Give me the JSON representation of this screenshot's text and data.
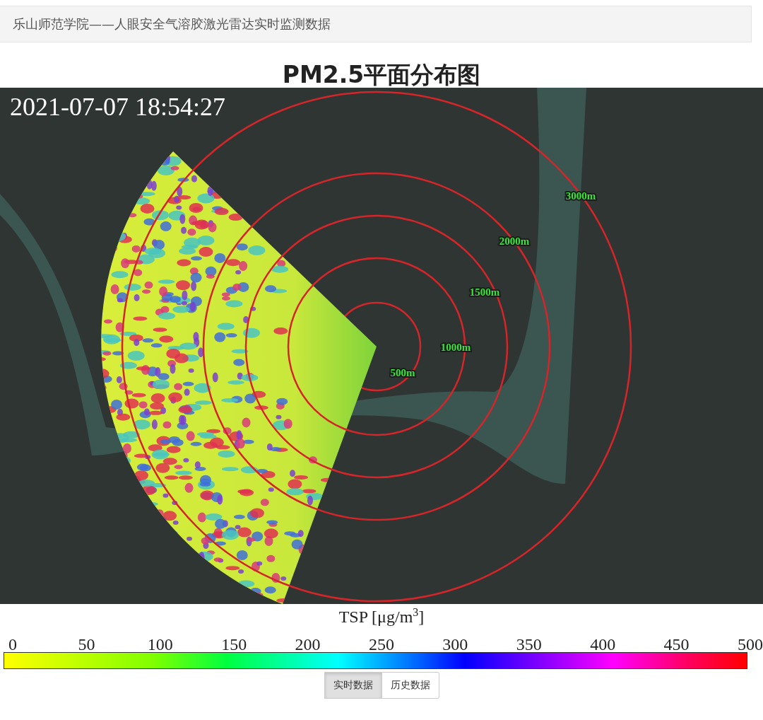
{
  "header": {
    "title": "乐山师范学院——人眼安全气溶胶激光雷达实时监测数据"
  },
  "map": {
    "title": "PM2.5平面分布图",
    "timestamp": "2021-07-07 18:54:27",
    "rings": [
      {
        "label": "500m"
      },
      {
        "label": "1000m"
      },
      {
        "label": "1500m"
      },
      {
        "label": "2000m"
      },
      {
        "label": "3000m"
      }
    ]
  },
  "colorbar": {
    "title": "TSP [μg/m$^{3}$]",
    "ticks": [
      "0",
      "50",
      "100",
      "150",
      "200",
      "250",
      "300",
      "350",
      "400",
      "450",
      "500"
    ]
  },
  "tabs": [
    {
      "label": "实时数据",
      "selected": true
    },
    {
      "label": "历史数据",
      "selected": false
    }
  ]
}
